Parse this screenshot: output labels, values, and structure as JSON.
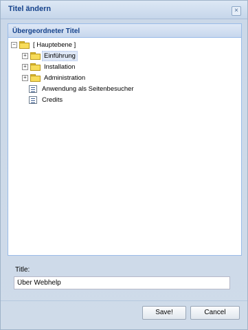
{
  "dialog": {
    "title": "Titel ändern",
    "close_glyph": "×"
  },
  "tree": {
    "header": "Übergeordneter Titel",
    "nodes": [
      {
        "label": "[ Hauptebene ]",
        "expander": "⊟",
        "icon": "folder-open-icon"
      },
      {
        "label": "Einführung",
        "expander": "⊞",
        "icon": "folder-icon",
        "selected": true
      },
      {
        "label": "Installation",
        "expander": "⊞",
        "icon": "folder-icon"
      },
      {
        "label": "Administration",
        "expander": "⊞",
        "icon": "folder-icon"
      },
      {
        "label": "Anwendung als Seitenbesucher",
        "icon": "page-icon"
      },
      {
        "label": "Credits",
        "icon": "page-icon"
      }
    ]
  },
  "form": {
    "title_label": "Title:",
    "title_value": "Über Webhelp"
  },
  "buttons": {
    "save": "Save!",
    "cancel": "Cancel"
  }
}
